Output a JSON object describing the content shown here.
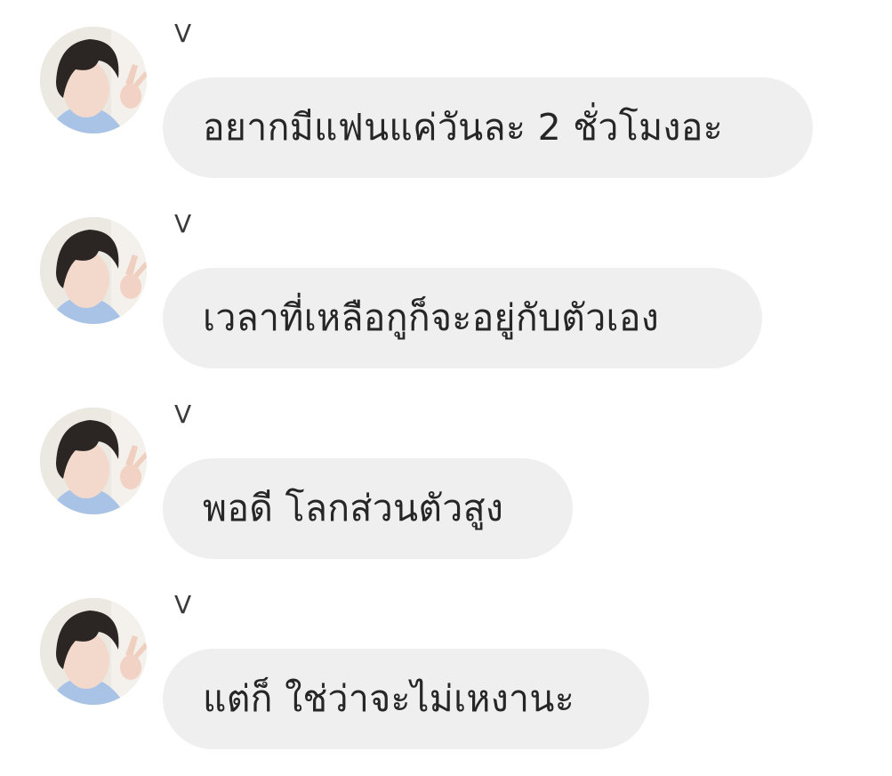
{
  "conversation": {
    "messages": [
      {
        "sender": "V",
        "text": "อยากมีแฟนแค่วันละ 2 ชั่วโมงอะ"
      },
      {
        "sender": "V",
        "text": "เวลาที่เหลือกูก็จะอยู่กับตัวเอง"
      },
      {
        "sender": "V",
        "text": "พอดี โลกส่วนตัวสูง"
      },
      {
        "sender": "V",
        "text": "แต่ก็ ใช่ว่าจะไม่เหงานะ"
      }
    ]
  },
  "colors": {
    "bubble_background": "#efefef",
    "text": "#262626",
    "background": "#ffffff"
  }
}
